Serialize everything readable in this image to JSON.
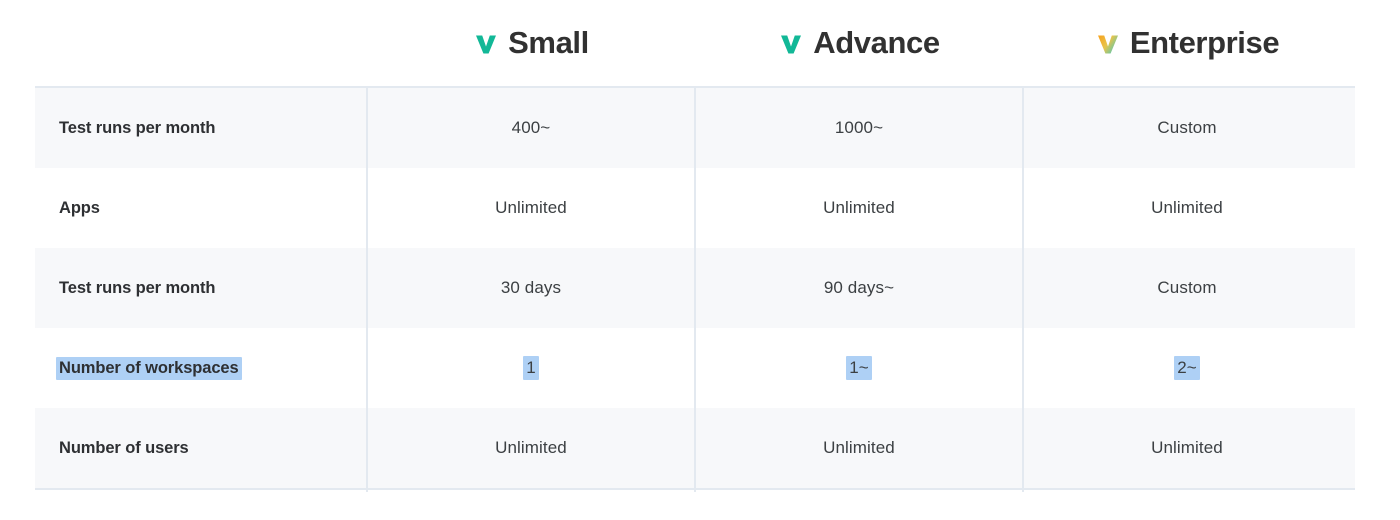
{
  "table": {
    "feature_column_header": "",
    "plans": [
      {
        "name": "Small",
        "icon": "checkmark-icon",
        "icon_color_start": "#f5a623",
        "icon_color_end": "#12b897",
        "gradient": false
      },
      {
        "name": "Advance",
        "icon": "checkmark-icon",
        "icon_color_start": "#12b897",
        "icon_color_end": "#12b897",
        "gradient": false
      },
      {
        "name": "Enterprise",
        "icon": "checkmark-icon",
        "icon_color_start": "#f5a623",
        "icon_color_end": "#3fc9c2",
        "gradient": true
      }
    ],
    "rows": [
      {
        "feature": "Test runs per month",
        "values": [
          "400~",
          "1000~",
          "Custom"
        ],
        "shaded": true,
        "selected": false
      },
      {
        "feature": "Apps",
        "values": [
          "Unlimited",
          "Unlimited",
          "Unlimited"
        ],
        "shaded": false,
        "selected": false
      },
      {
        "feature": "Test runs per month",
        "values": [
          "30 days",
          "90 days~",
          "Custom"
        ],
        "shaded": true,
        "selected": false
      },
      {
        "feature": "Number of workspaces",
        "values": [
          "1",
          "1~",
          "2~"
        ],
        "shaded": false,
        "selected": true
      },
      {
        "feature": "Number of users",
        "values": [
          "Unlimited",
          "Unlimited",
          "Unlimited"
        ],
        "shaded": true,
        "selected": false
      }
    ]
  },
  "colors": {
    "teal": "#12b897",
    "amber": "#f5a623",
    "selection_highlight": "#aed0f5",
    "row_shaded": "#f7f8fa",
    "divider": "#e3e9f0",
    "text_primary": "#2e3033"
  }
}
